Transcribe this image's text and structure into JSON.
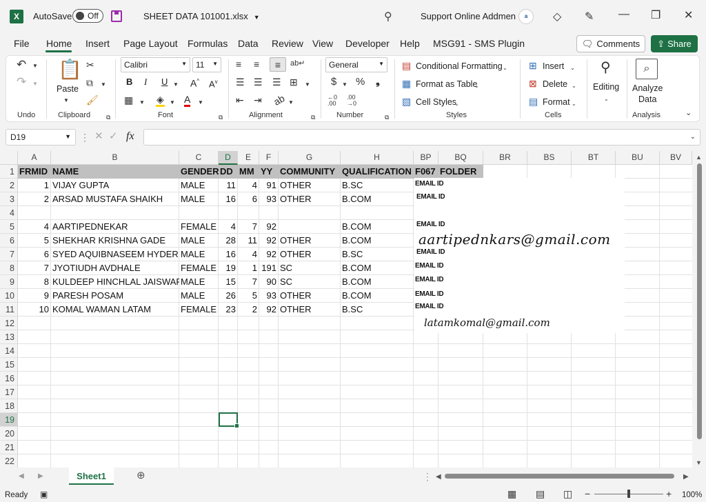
{
  "app": {
    "autosave_label": "AutoSave",
    "autosave_state": "Off",
    "file_name": "SHEET DATA 101001.xlsx",
    "account_name": "Support Online Addmen",
    "logo_glyph": "X",
    "avatar_text": "a"
  },
  "menu": {
    "tabs": [
      "File",
      "Home",
      "Insert",
      "Page Layout",
      "Formulas",
      "Data",
      "Review",
      "View",
      "Developer",
      "Help",
      "MSG91 - SMS Plugin"
    ],
    "comments": "Comments",
    "share": "Share"
  },
  "ribbon": {
    "groups": {
      "undo": "Undo",
      "clipboard": "Clipboard",
      "font": "Font",
      "alignment": "Alignment",
      "number": "Number",
      "styles": "Styles",
      "cells": "Cells",
      "analysis": "Analysis"
    },
    "paste": "Paste",
    "font_name": "Calibri",
    "font_size": "11",
    "number_format": "General",
    "conditional_formatting": "Conditional Formatting",
    "format_as_table": "Format as Table",
    "cell_styles": "Cell Styles",
    "insert": "Insert",
    "delete": "Delete",
    "format": "Format",
    "editing": "Editing",
    "analyze_line1": "Analyze",
    "analyze_line2": "Data"
  },
  "formula_bar": {
    "name_box": "D19",
    "fx": "fx",
    "value": ""
  },
  "grid": {
    "columns": [
      "A",
      "B",
      "C",
      "D",
      "E",
      "F",
      "G",
      "H",
      "BP",
      "BQ",
      "BR",
      "BS",
      "BT",
      "BU",
      "BV"
    ],
    "rows": [
      "1",
      "2",
      "3",
      "4",
      "5",
      "6",
      "7",
      "8",
      "9",
      "10",
      "11",
      "12",
      "13",
      "14",
      "15",
      "16",
      "17",
      "18",
      "19",
      "20",
      "21",
      "22"
    ],
    "header_row": [
      "FRMID",
      "NAME",
      "GENDER",
      "DD",
      "MM",
      "YY",
      "COMMUNITY",
      "QUALIFICATION",
      "F067",
      "FOLDER"
    ],
    "data": [
      [
        "1",
        "VIJAY GUPTA",
        "MALE",
        "11",
        "4",
        "91",
        "OTHER",
        "B.SC"
      ],
      [
        "2",
        "ARSAD MUSTAFA SHAIKH",
        "MALE",
        "16",
        "6",
        "93",
        "OTHER",
        "B.COM"
      ],
      [
        "",
        "",
        "",
        "",
        "",
        "",
        "",
        ""
      ],
      [
        "4",
        "AARTIPEDNEKAR",
        "FEMALE",
        "4",
        "7",
        "92",
        "",
        "B.COM"
      ],
      [
        "5",
        "SHEKHAR KRISHNA GADE",
        "MALE",
        "28",
        "11",
        "92",
        "OTHER",
        "B.COM"
      ],
      [
        "6",
        "SYED AQUIBNASEEM  HYDER",
        "MALE",
        "16",
        "4",
        "92",
        "OTHER",
        "B.SC"
      ],
      [
        "7",
        "JYOTIUDH AVDHALE",
        "FEMALE",
        "19",
        "1",
        "191",
        "SC",
        "B.COM"
      ],
      [
        "8",
        "KULDEEP HINCHLAL JAISWAR",
        "MALE",
        "15",
        "7",
        "90",
        "SC",
        "B.COM"
      ],
      [
        "9",
        "PARESH POSAM",
        "MALE",
        "26",
        "5",
        "93",
        "OTHER",
        "B.COM"
      ],
      [
        "10",
        "KOMAL  WAMAN  LATAM",
        "FEMALE",
        "23",
        "2",
        "92",
        "OTHER",
        "B.SC"
      ]
    ],
    "scanned_image": {
      "email_label": "EMAIL ID",
      "handwritten_1": "aartipednkars@gmail.com",
      "handwritten_2": "latamkomal@gmail.com"
    },
    "selected_cell": "D19"
  },
  "sheets": [
    "Sheet1"
  ],
  "status": {
    "ready": "Ready",
    "zoom": "100%"
  },
  "colors": {
    "accent": "#1e7145",
    "header_band": "#c0c0c0"
  }
}
